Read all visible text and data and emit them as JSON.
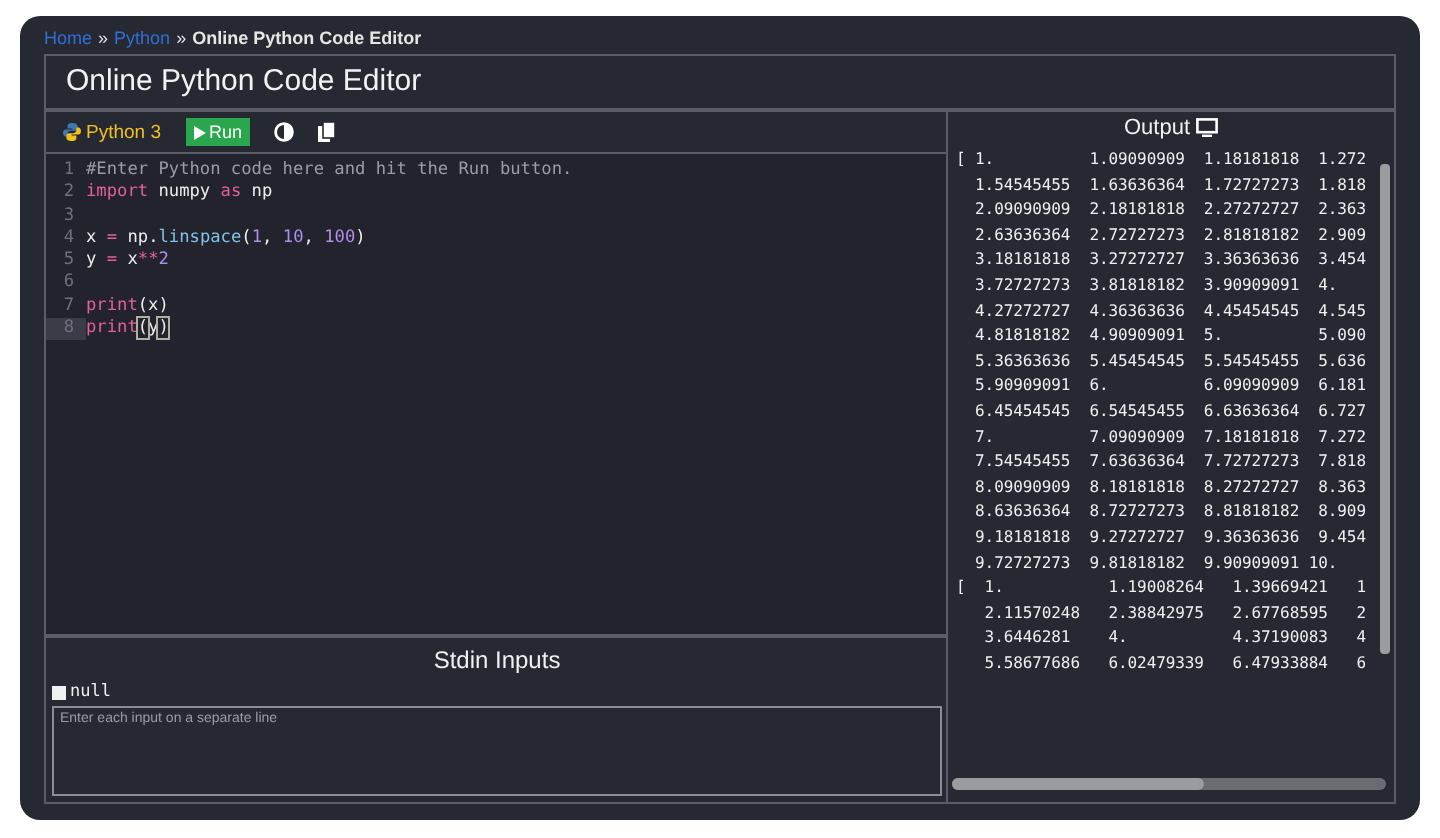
{
  "breadcrumb": [
    {
      "label": "Home",
      "kind": "link"
    },
    {
      "label": "»",
      "kind": "separator"
    },
    {
      "label": "Python",
      "kind": "link"
    },
    {
      "label": "»",
      "kind": "separator"
    },
    {
      "label": "Online Python Code Editor",
      "kind": "current"
    }
  ],
  "title": "Online Python Code Editor",
  "toolbar": {
    "language": "Python 3",
    "run_button": "Run"
  },
  "code_lines": [
    {
      "number": "1",
      "selected": false,
      "tokens": [
        {
          "kind": "comment",
          "text": "#Enter Python code here and hit the Run button."
        }
      ]
    },
    {
      "number": "2",
      "selected": false,
      "tokens": [
        {
          "kind": "keyword",
          "text": "import"
        },
        {
          "kind": "plain",
          "text": " numpy "
        },
        {
          "kind": "keyword",
          "text": "as"
        },
        {
          "kind": "plain",
          "text": " np"
        }
      ]
    },
    {
      "number": "3",
      "selected": false
    },
    {
      "number": "4",
      "selected": false,
      "tokens": [
        {
          "kind": "plain",
          "text": "x "
        },
        {
          "kind": "operator",
          "text": "="
        },
        {
          "kind": "plain",
          "text": " np."
        },
        {
          "kind": "function",
          "text": "linspace"
        },
        {
          "kind": "plain",
          "text": "("
        },
        {
          "kind": "number",
          "text": "1"
        },
        {
          "kind": "plain",
          "text": ", "
        },
        {
          "kind": "number",
          "text": "10"
        },
        {
          "kind": "plain",
          "text": ", "
        },
        {
          "kind": "number",
          "text": "100"
        },
        {
          "kind": "plain",
          "text": ")"
        }
      ]
    },
    {
      "number": "5",
      "selected": false,
      "tokens": [
        {
          "kind": "plain",
          "text": "y "
        },
        {
          "kind": "operator",
          "text": "="
        },
        {
          "kind": "plain",
          "text": " x"
        },
        {
          "kind": "operator",
          "text": "**"
        },
        {
          "kind": "number",
          "text": "2"
        }
      ]
    },
    {
      "number": "6",
      "selected": false
    },
    {
      "number": "7",
      "selected": false,
      "tokens": [
        {
          "kind": "keyword",
          "text": "print"
        },
        {
          "kind": "plain",
          "text": "(x)"
        }
      ]
    },
    {
      "number": "8",
      "selected": true,
      "tokens": [
        {
          "kind": "keyword",
          "text": "print"
        },
        {
          "kind": "bracket",
          "text": "("
        },
        {
          "kind": "plain",
          "text": "y"
        },
        {
          "kind": "bracket",
          "text": ")"
        }
      ]
    }
  ],
  "stdin": {
    "title": "Stdin Inputs",
    "checkbox_label": "null",
    "checked": false,
    "placeholder": "Enter each input on a separate line"
  },
  "output": {
    "title": "Output",
    "lines": [
      "[ 1.          1.09090909  1.18181818  1.272",
      "  1.54545455  1.63636364  1.72727273  1.818",
      "  2.09090909  2.18181818  2.27272727  2.363",
      "  2.63636364  2.72727273  2.81818182  2.909",
      "  3.18181818  3.27272727  3.36363636  3.454",
      "  3.72727273  3.81818182  3.90909091  4.",
      "  4.27272727  4.36363636  4.45454545  4.545",
      "  4.81818182  4.90909091  5.          5.090",
      "  5.36363636  5.45454545  5.54545455  5.636",
      "  5.90909091  6.          6.09090909  6.181",
      "  6.45454545  6.54545455  6.63636364  6.727",
      "  7.          7.09090909  7.18181818  7.272",
      "  7.54545455  7.63636364  7.72727273  7.818",
      "  8.09090909  8.18181818  8.27272727  8.363",
      "  8.63636364  8.72727273  8.81818182  8.909",
      "  9.18181818  9.27272727  9.36363636  9.454",
      "  9.72727273  9.81818182  9.90909091 10.",
      "[  1.           1.19008264   1.39669421   1",
      "   2.11570248   2.38842975   2.67768595   2",
      "   3.6446281    4.           4.37190083   4",
      "   5.58677686   6.02479339   6.47933884   6"
    ]
  }
}
